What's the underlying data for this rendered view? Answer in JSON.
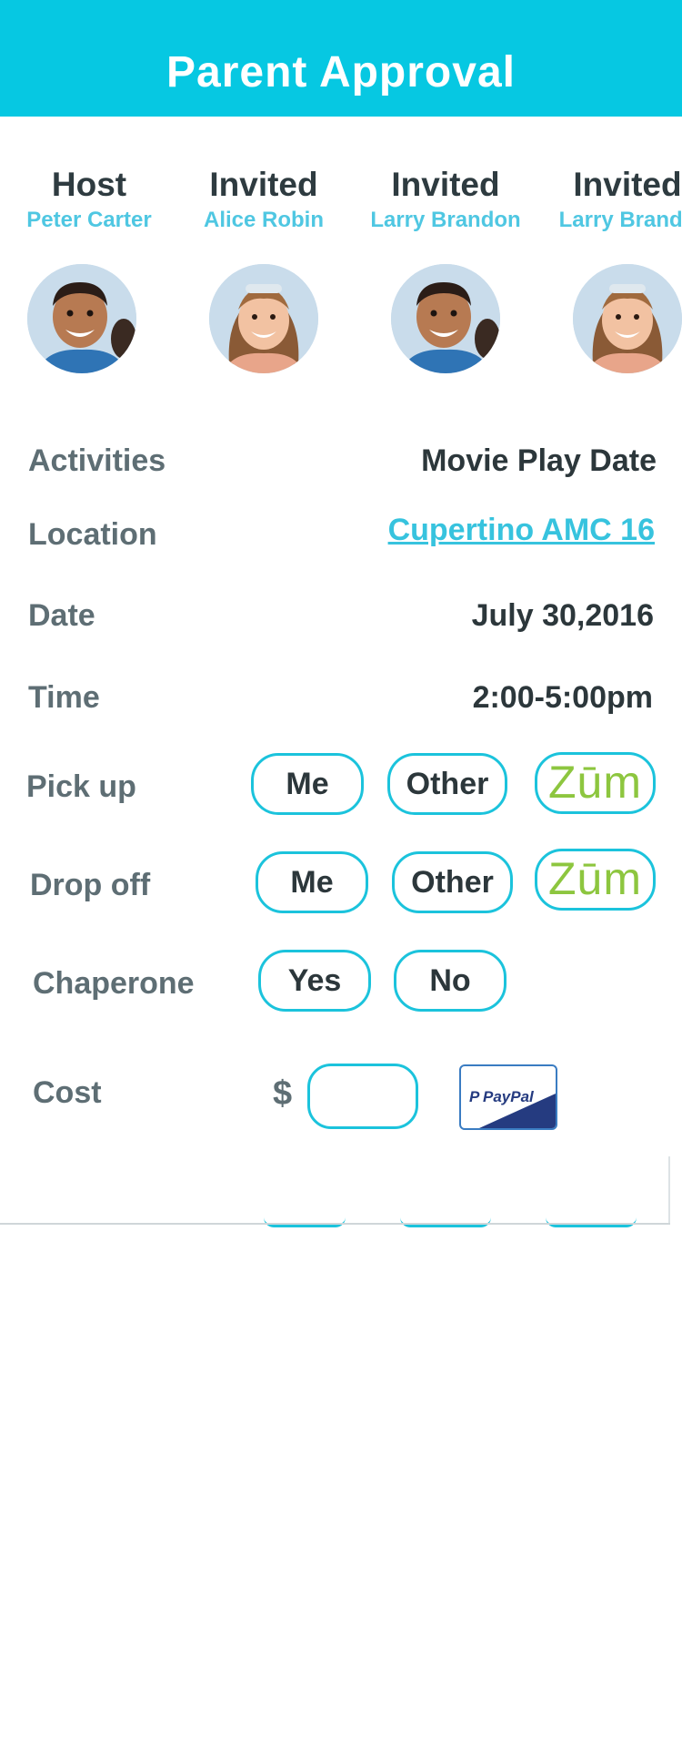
{
  "header": {
    "title": "Parent Approval"
  },
  "participants": [
    {
      "role": "Host",
      "name": "Peter Carter",
      "avatar": "boy-avatar"
    },
    {
      "role": "Invited",
      "name": "Alice Robin",
      "avatar": "girl-avatar"
    },
    {
      "role": "Invited",
      "name": "Larry Brandon",
      "avatar": "boy-avatar"
    },
    {
      "role": "Invited",
      "name": "Larry Brando",
      "avatar": "girl-avatar"
    }
  ],
  "details": {
    "activities": {
      "label": "Activities",
      "value": "Movie Play Date"
    },
    "location": {
      "label": "Location",
      "value": "Cupertino AMC 16"
    },
    "date": {
      "label": "Date",
      "value": "July 30,2016"
    },
    "time": {
      "label": "Time",
      "value": "2:00-5:00pm"
    }
  },
  "pickup": {
    "label": "Pick up",
    "options": [
      "Me",
      "Other",
      "Zūm"
    ]
  },
  "dropoff": {
    "label": "Drop off",
    "options": [
      "Me",
      "Other",
      "Zūm"
    ]
  },
  "chaperone": {
    "label": "Chaperone",
    "options": [
      "Yes",
      "No"
    ]
  },
  "cost": {
    "label": "Cost",
    "currency": "$",
    "value": "",
    "paypal_label": "PayPal"
  },
  "colors": {
    "header": "#06c8e2",
    "accent": "#1bc3dc",
    "link": "#37c3de",
    "zum": "#8dc63f",
    "label": "#5e6e74",
    "value": "#2c373b",
    "paypal_dark": "#253b80",
    "paypal_light": "#179bd7"
  }
}
